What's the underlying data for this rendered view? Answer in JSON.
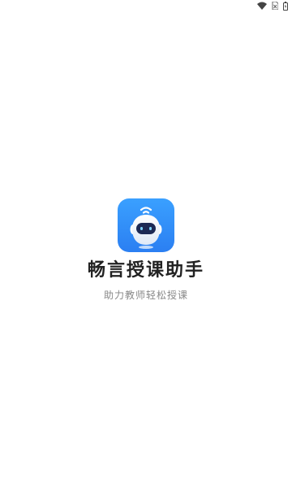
{
  "status_bar": {
    "icons": [
      "wifi-icon",
      "no-sim-icon",
      "battery-icon"
    ]
  },
  "splash": {
    "logo_icon": "robot-logo-icon",
    "app_name": "畅言授课助手",
    "slogan": "助力教师轻松授课"
  },
  "colors": {
    "logo_gradient_top": "#3aa0ff",
    "logo_gradient_bottom": "#2b7ff2",
    "title_text": "#222222",
    "slogan_text": "#888888"
  }
}
